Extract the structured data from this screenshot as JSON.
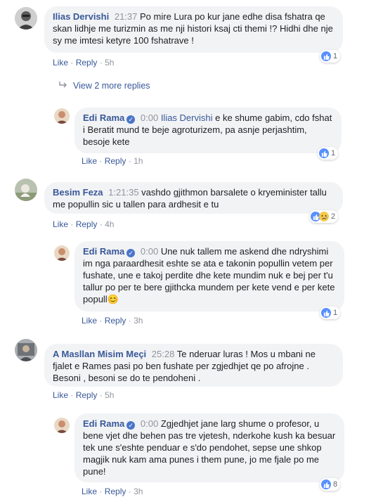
{
  "comments": [
    {
      "author": "Ilias Dervishi",
      "time": "21:37",
      "text": "Po mire Lura po kur jane edhe disa fshatra qe skan lidhje me turizmin as me nji histori ksaj cti themi !? Hidhi dhe nje sy me imtesi ketyre 100 fshatrave !",
      "like": "Like",
      "reply": "Reply",
      "age": "5h",
      "reactions": "1"
    },
    {
      "author": "Edi Rama",
      "time": "0:00",
      "mention": "Ilias Dervishi",
      "text": "e ke shume gabim, cdo fshat i Beratit mund te beje agroturizem, pa asnje perjashtim, besoje kete",
      "like": "Like",
      "reply": "Reply",
      "age": "1h",
      "reactions": "1"
    },
    {
      "author": "Besim Feza",
      "time": "1:21:35",
      "text": "vashdo gjithmon barsalete o kryeminister tallu me popullin sic u tallen para ardhesit e tu",
      "like": "Like",
      "reply": "Reply",
      "age": "4h",
      "reactions": "2"
    },
    {
      "author": "Edi Rama",
      "time": "0:00",
      "text": "Une nuk tallem me askend dhe ndryshimi im nga paraardhesit eshte se ata e takonin popullin vetem per fushate, une e takoj perdite dhe kete mundim nuk e bej per t'u tallur po per te bere gjithcka mundem per kete vend e per kete popull",
      "emoji": "😊",
      "like": "Like",
      "reply": "Reply",
      "age": "3h",
      "reactions": "1"
    },
    {
      "author": "A Masllan Misim Meçi",
      "time": "25:28",
      "text": "Te nderuar luras ! Mos u mbani ne fjalet e Rames pasi po ben fushate per zgjedhjet qe po afrojne . Besoni , besoni se do te pendoheni .",
      "like": "Like",
      "reply": "Reply",
      "age": "5h"
    },
    {
      "author": "Edi Rama",
      "time": "0:00",
      "text": "Zgjedhjet jane larg shume o profesor, u bene vjet dhe behen pas tre vjetesh, nderkohe kush ka besuar tek une s'eshte penduar e s'do pendohet, sepse une shkop magjik nuk kam ama punes i them pune, jo me fjale po me pune!",
      "like": "Like",
      "reply": "Reply",
      "age": "3h",
      "reactions": "8"
    }
  ],
  "view_more": "View 2 more replies",
  "separator": "·",
  "colors": {
    "link": "#385898",
    "bubble": "#f2f3f5",
    "meta": "#90949c",
    "like": "#5890ff"
  }
}
